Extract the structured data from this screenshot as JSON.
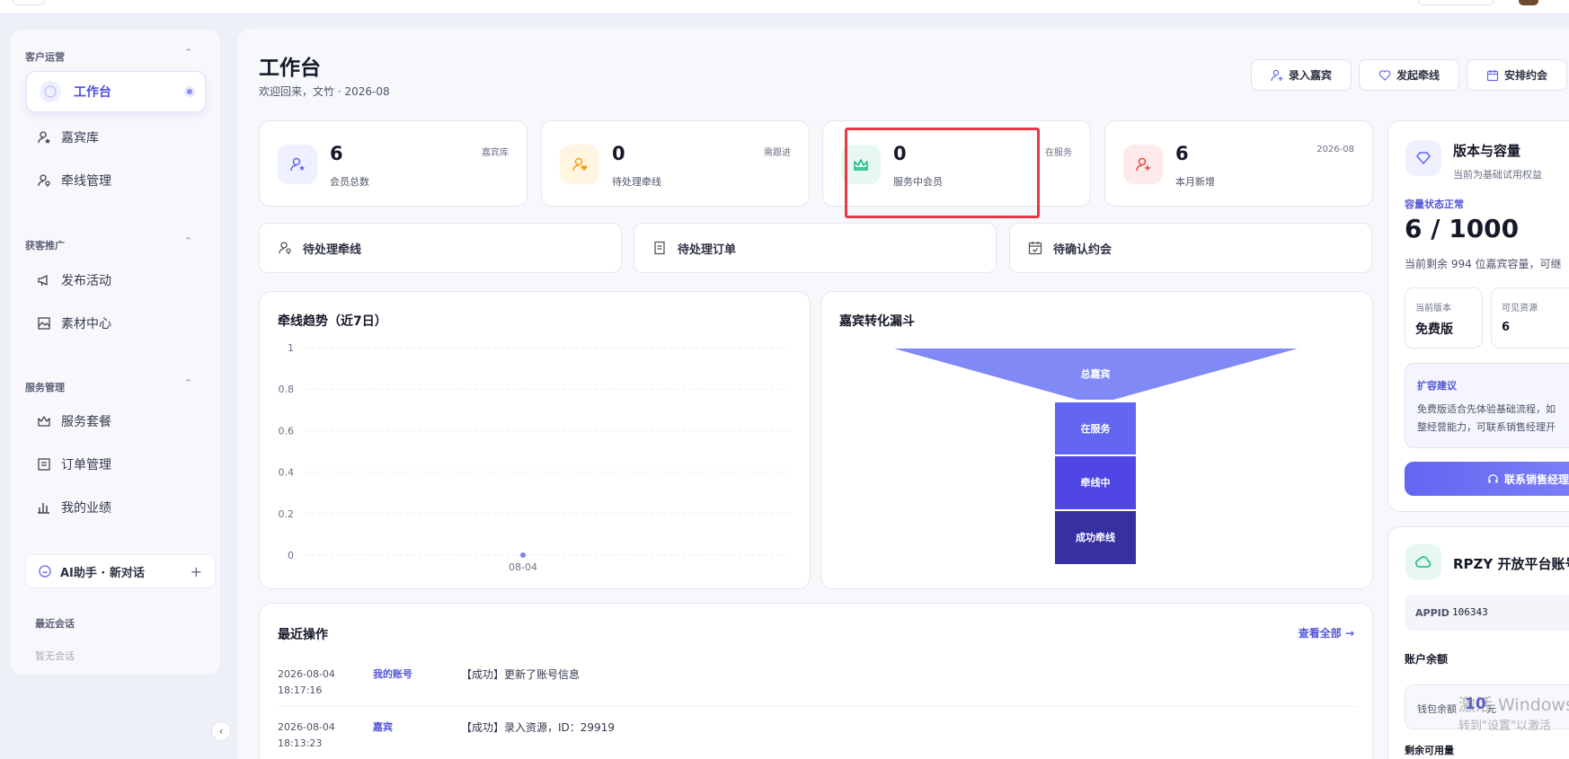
{
  "sidebar": {
    "groups": [
      {
        "title": "客户运营",
        "items": [
          {
            "label": "工作台",
            "icon": "dashboard-icon",
            "active": true
          },
          {
            "label": "嘉宾库",
            "icon": "user-star-icon"
          },
          {
            "label": "牵线管理",
            "icon": "user-link-icon"
          }
        ]
      },
      {
        "title": "获客推广",
        "items": [
          {
            "label": "发布活动",
            "icon": "megaphone-icon"
          },
          {
            "label": "素材中心",
            "icon": "image-icon"
          }
        ]
      },
      {
        "title": "服务管理",
        "items": [
          {
            "label": "服务套餐",
            "icon": "crown-icon"
          },
          {
            "label": "订单管理",
            "icon": "order-icon"
          },
          {
            "label": "我的业绩",
            "icon": "bar-chart-icon"
          }
        ]
      }
    ],
    "ai_assistant": "AI助手 · 新对话",
    "recent_title": "最近会话",
    "recent_empty": "暂无会话"
  },
  "header": {
    "title": "工作台",
    "subtitle": "欢迎回来，文竹 · 2026-08",
    "buttons": [
      "录入嘉宾",
      "发起牵线",
      "安排约会"
    ]
  },
  "stats": [
    {
      "value": "6",
      "label": "会员总数",
      "tag": "嘉宾库",
      "color": "#6366f1",
      "bg": "#eef0ff"
    },
    {
      "value": "0",
      "label": "待处理牵线",
      "tag": "需跟进",
      "color": "#f59e0b",
      "bg": "#fff5e1"
    },
    {
      "value": "0",
      "label": "服务中会员",
      "tag": "在服务",
      "color": "#10b981",
      "bg": "#e6f8f1"
    },
    {
      "value": "6",
      "label": "本月新增",
      "tag": "2026-08",
      "color": "#ef4444",
      "bg": "#fdeaea"
    }
  ],
  "tasks": [
    "待处理牵线",
    "待处理订单",
    "待确认约会"
  ],
  "trend_panel": {
    "title": "牵线趋势（近7日）"
  },
  "funnel_panel": {
    "title": "嘉宾转化漏斗",
    "stages": [
      "总嘉宾",
      "在服务",
      "牵线中",
      "成功牵线"
    ],
    "colors": [
      "#8189f6",
      "#6366f1",
      "#4f46e5",
      "#3730a3"
    ]
  },
  "chart_data": {
    "type": "line",
    "x": [
      "08-04"
    ],
    "series": [
      {
        "values": [
          0
        ]
      }
    ],
    "yticks": [
      "1",
      "0.8",
      "0.6",
      "0.4",
      "0.2",
      "0"
    ],
    "ylim": [
      0,
      1
    ],
    "grid": true
  },
  "recent_ops": {
    "title": "最近操作",
    "view_all": "查看全部 →",
    "rows": [
      {
        "date": "2026-08-04",
        "time": "18:17:16",
        "who": "我的账号",
        "desc": "【成功】更新了账号信息"
      },
      {
        "date": "2026-08-04",
        "time": "18:13:23",
        "who": "嘉宾",
        "desc": "【成功】录入资源，ID：29919"
      }
    ]
  },
  "version_card": {
    "title": "版本与容量",
    "subtitle": "当前为基础试用权益",
    "status": "容量状态正常",
    "capacity": "6 / 1000",
    "remaining": "当前剩余 994 位嘉宾容量，可继",
    "current_version_label": "当前版本",
    "current_version": "免费版",
    "visible_label": "可见资源",
    "visible": "6",
    "advice_title": "扩容建议",
    "advice_line1": "免费版适合先体验基础流程，如",
    "advice_line2": "整经营能力，可联系销售经理开",
    "contact": "联系销售经理"
  },
  "account_card": {
    "title": "RPZY 开放平台账号",
    "appid_label": "APPID",
    "appid": "106343",
    "balance_title": "账户余额",
    "wallet_label": "钱包余额",
    "wallet_value": "10",
    "wallet_unit": "元",
    "remaining_title": "剩余可用量"
  },
  "watermark": {
    "line1": "激活 Windows",
    "line2": "转到\"设置\"以激活"
  }
}
